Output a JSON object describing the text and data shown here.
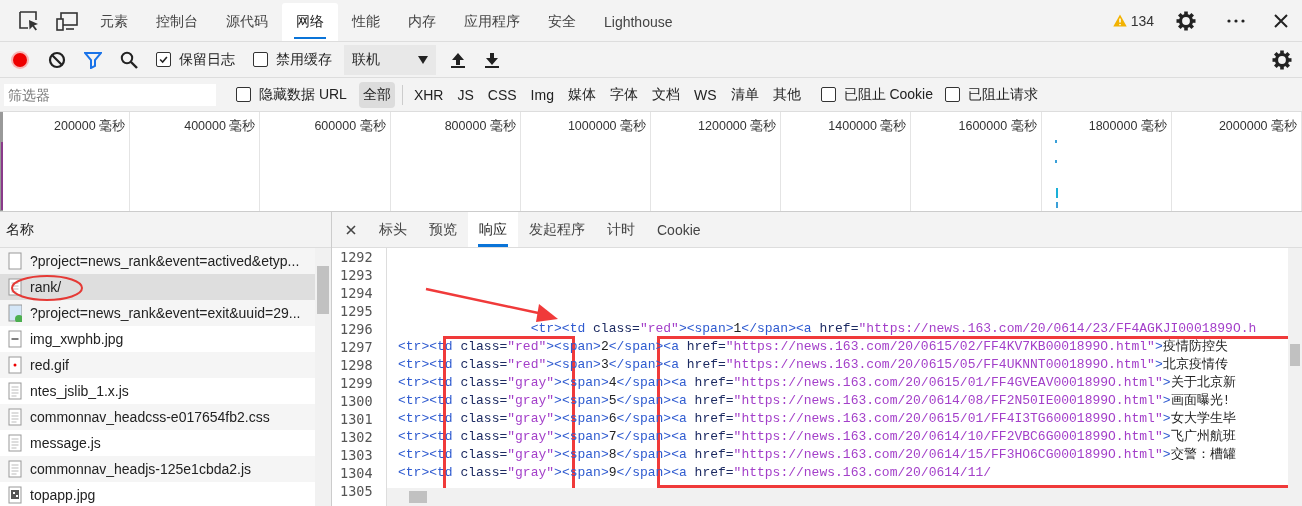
{
  "main_tabs": [
    {
      "label": "元素",
      "selected": false
    },
    {
      "label": "控制台",
      "selected": false
    },
    {
      "label": "源代码",
      "selected": false
    },
    {
      "label": "网络",
      "selected": true
    },
    {
      "label": "性能",
      "selected": false
    },
    {
      "label": "内存",
      "selected": false
    },
    {
      "label": "应用程序",
      "selected": false
    },
    {
      "label": "安全",
      "selected": false
    },
    {
      "label": "Lighthouse",
      "selected": false
    }
  ],
  "warnings": {
    "count": "134"
  },
  "toolbar": {
    "recording": true,
    "preserve_log": {
      "label": "保留日志",
      "checked": true
    },
    "disable_cache": {
      "label": "禁用缓存",
      "checked": false
    },
    "throttling": {
      "value": "联机"
    }
  },
  "filter_bar": {
    "filter": {
      "placeholder": "筛选器"
    },
    "hide_data_urls": {
      "label": "隐藏数据 URL",
      "checked": false
    },
    "types": [
      {
        "label": "全部",
        "selected": true
      },
      {
        "label": "XHR",
        "selected": false
      },
      {
        "label": "JS",
        "selected": false
      },
      {
        "label": "CSS",
        "selected": false
      },
      {
        "label": "Img",
        "selected": false
      },
      {
        "label": "媒体",
        "selected": false
      },
      {
        "label": "字体",
        "selected": false
      },
      {
        "label": "文档",
        "selected": false
      },
      {
        "label": "WS",
        "selected": false
      },
      {
        "label": "清单",
        "selected": false
      },
      {
        "label": "其他",
        "selected": false
      }
    ],
    "blocked_cookies": {
      "label": "已阻止 Cookie",
      "checked": false
    },
    "blocked_requests": {
      "label": "已阻止请求",
      "checked": false
    }
  },
  "overview": {
    "ticks": [
      "200000 毫秒",
      "400000 毫秒",
      "600000 毫秒",
      "800000 毫秒",
      "1000000 毫秒",
      "1200000 毫秒",
      "1400000 毫秒",
      "1600000 毫秒",
      "1800000 毫秒",
      "2000000 毫秒"
    ]
  },
  "requests": {
    "header": "名称",
    "items": [
      {
        "name": "?project=news_rank&event=actived&etyp...",
        "kind": "blank",
        "selected": false
      },
      {
        "name": "rank/",
        "kind": "document",
        "selected": true
      },
      {
        "name": "?project=news_rank&event=exit&uuid=29...",
        "kind": "image",
        "selected": false
      },
      {
        "name": "img_xwphb.jpg",
        "kind": "dash",
        "selected": false
      },
      {
        "name": "red.gif",
        "kind": "dot",
        "selected": false
      },
      {
        "name": "ntes_jslib_1.x.js",
        "kind": "document",
        "selected": false
      },
      {
        "name": "commonnav_headcss-e017654fb2.css",
        "kind": "document",
        "selected": false
      },
      {
        "name": "message.js",
        "kind": "document",
        "selected": false
      },
      {
        "name": "commonnav_headjs-125e1cbda2.js",
        "kind": "document",
        "selected": false
      },
      {
        "name": "topapp.jpg",
        "kind": "qr",
        "selected": false
      }
    ]
  },
  "detail": {
    "tabs": [
      {
        "label": "标头",
        "selected": false
      },
      {
        "label": "预览",
        "selected": false
      },
      {
        "label": "响应",
        "selected": true
      },
      {
        "label": "发起程序",
        "selected": false
      },
      {
        "label": "计时",
        "selected": false
      },
      {
        "label": "Cookie",
        "selected": false
      }
    ],
    "lines": [
      {
        "number": "1292"
      },
      {
        "number": "1293"
      },
      {
        "number": "1294"
      },
      {
        "number": "1295"
      },
      {
        "number": "1296",
        "code": "                 <tr><td class=\"red\"><span>1</span><a href=\"https://news.163.com/20/0614/23/FF4AGKJI0001899O.h"
      },
      {
        "number": "1297",
        "code": "<tr><td class=\"red\"><span>2</span><a href=\"https://news.163.com/20/0615/02/FF4KV7KB0001899O.html\">疫情防控失"
      },
      {
        "number": "1298",
        "code": "<tr><td class=\"red\"><span>3</span><a href=\"https://news.163.com/20/0615/05/FF4UKNNT0001899O.html\">北京疫情传"
      },
      {
        "number": "1299",
        "code": "<tr><td class=\"gray\"><span>4</span><a href=\"https://news.163.com/20/0615/01/FF4GVEAV0001899O.html\">关于北京新"
      },
      {
        "number": "1300",
        "code": "<tr><td class=\"gray\"><span>5</span><a href=\"https://news.163.com/20/0614/08/FF2N50IE0001899O.html\">画面曝光!"
      },
      {
        "number": "1301",
        "code": "<tr><td class=\"gray\"><span>6</span><a href=\"https://news.163.com/20/0615/01/FF4I3TG60001899O.html\">女大学生毕"
      },
      {
        "number": "1302",
        "code": "<tr><td class=\"gray\"><span>7</span><a href=\"https://news.163.com/20/0614/10/FF2VBC6G0001899O.html\">飞广州航班"
      },
      {
        "number": "1303",
        "code": "<tr><td class=\"gray\"><span>8</span><a href=\"https://news.163.com/20/0614/15/FF3HO6CG0001899O.html\">交警：槽罐"
      },
      {
        "number": "1304",
        "code": "<tr><td class=\"gray\"><span>9</span><a href=\"https://news.163.com/20/0614/11/"
      },
      {
        "number": "1305"
      }
    ]
  }
}
